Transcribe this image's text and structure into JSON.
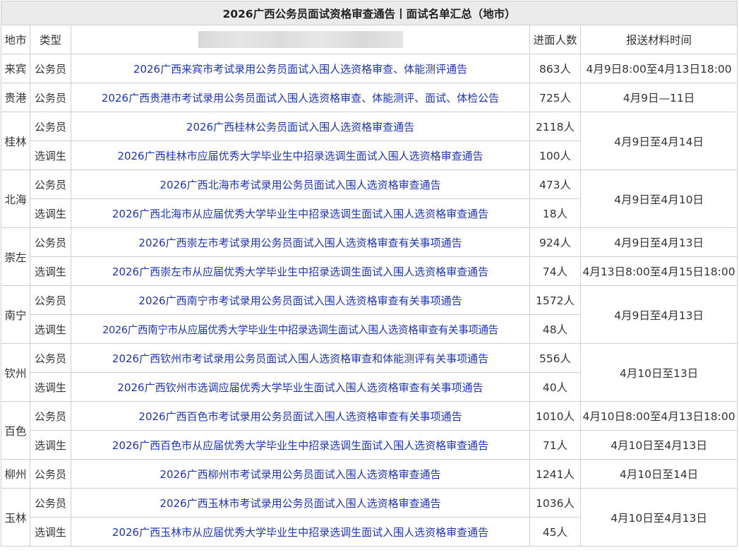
{
  "title": "2026广西公务员面试资格审查通告丨面试名单汇总（地市）",
  "headers": {
    "city": "地市",
    "type": "类型",
    "count": "进面人数",
    "time": "报送材料时间"
  },
  "rows": [
    {
      "city": "来宾",
      "type": "公务员",
      "notice": "2026广西来宾市考试录用公务员面试入围人选资格审查、体能测评通告",
      "count": "863人",
      "time": "4月9日8:00至4月13日18:00"
    },
    {
      "city": "贵港",
      "type": "公务员",
      "notice": "2026广西贵港市考试录用公务员面试入围人选资格审查、体能测评、面试、体检公告",
      "count": "725人",
      "time": "4月9日—11日"
    },
    {
      "city": "桂林",
      "type": "公务员",
      "notice": "2026广西桂林公务员面试入围人选资格审查通告",
      "count": "2118人",
      "time": "4月9日至4月14日"
    },
    {
      "type": "选调生",
      "notice": "2026广西桂林市应届优秀大学毕业生中招录选调生面试入围人选资格审查通告",
      "count": "100人"
    },
    {
      "city": "北海",
      "type": "公务员",
      "notice": "2026广西北海市考试录用公务员面试入围人选资格审查通告",
      "count": "473人",
      "time": "4月9日至4月10日"
    },
    {
      "type": "选调生",
      "notice": "2026广西北海市从应届优秀大学毕业生中招录选调生面试入围人选资格审查通告",
      "count": "18人"
    },
    {
      "city": "崇左",
      "type": "公务员",
      "notice": "2026广西崇左市考试录用公务员面试入围人选资格审查有关事项通告",
      "count": "924人",
      "time": "4月9日至4月13日"
    },
    {
      "type": "选调生",
      "notice": "2026广西崇左市从应届优秀大学毕业生中招录选调生面试入围人选资格审查通告",
      "count": "74人",
      "time": "4月13日8:00至4月15日18:00"
    },
    {
      "city": "南宁",
      "type": "公务员",
      "notice": "2026广西南宁市考试录用公务员面试入围人选资格审查有关事项通告",
      "count": "1572人",
      "time": "4月9日至4月13日"
    },
    {
      "type": "选调生",
      "notice": "2026广西南宁市从应届优秀大学毕业生中招录选调生面试入围人选资格审查有关事项通告",
      "count": "48人"
    },
    {
      "city": "钦州",
      "type": "公务员",
      "notice": "2026广西钦州市考试录用公务员面试入围人选资格审查和体能测评有关事项通告",
      "count": "556人",
      "time": "4月10日至13日"
    },
    {
      "type": "选调生",
      "notice": "2026广西钦州市选调应届优秀大学毕业生面试入围人选资格审查有关事项通告",
      "count": "40人"
    },
    {
      "city": "百色",
      "type": "公务员",
      "notice": "2026广西百色市考试录用公务员面试入围人选资格审查有关事项通告",
      "count": "1010人",
      "time": "4月10日8:00至4月13日18:00"
    },
    {
      "type": "选调生",
      "notice": "2026广西百色市从应届优秀大学毕业生中招录选调生面试入围人选资格审查通告",
      "count": "71人",
      "time": "4月10日至4月13日"
    },
    {
      "city": "柳州",
      "type": "公务员",
      "notice": "2026广西柳州市考试录用公务员面试入围人选资格审查通告",
      "count": "1241人",
      "time": "4月10日至14日"
    },
    {
      "city": "玉林",
      "type": "公务员",
      "notice": "2026广西玉林市考试录用公务员面试入围人选资格审查通告",
      "count": "1036人",
      "time": "4月10日至4月13日"
    },
    {
      "type": "选调生",
      "notice": "2026广西玉林市从应届优秀大学毕业生中招录选调生面试入围人选资格审查通告",
      "count": "45人"
    }
  ]
}
